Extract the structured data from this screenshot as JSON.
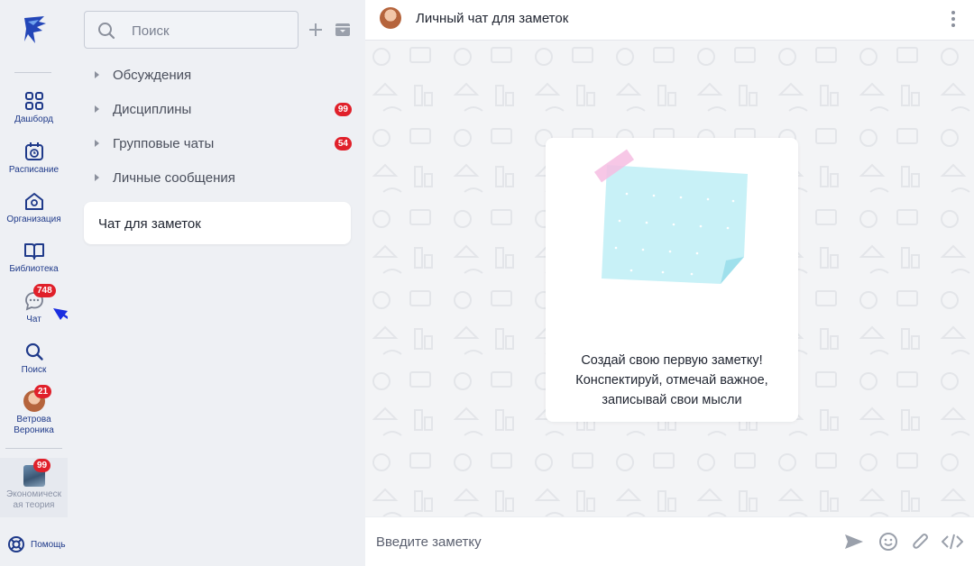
{
  "rail": {
    "items": [
      {
        "label": "Дашборд",
        "icon": "dashboard-icon"
      },
      {
        "label": "Расписание",
        "icon": "calendar-icon"
      },
      {
        "label": "Организация",
        "icon": "organization-icon"
      },
      {
        "label": "Библиотека",
        "icon": "book-icon"
      },
      {
        "label": "Чат",
        "icon": "chat-icon",
        "badge": "748"
      },
      {
        "label": "Поиск",
        "icon": "search-icon"
      }
    ],
    "profile": {
      "name_line1": "Ветрова",
      "name_line2": "Вероника",
      "badge": "21"
    },
    "course": {
      "name_line1": "Экономическ",
      "name_line2": "ая теория",
      "badge": "99"
    },
    "help_label": "Помощь"
  },
  "list": {
    "search_placeholder": "Поиск",
    "groups": [
      {
        "label": "Обсуждения",
        "badge": ""
      },
      {
        "label": "Дисциплины",
        "badge": "99"
      },
      {
        "label": "Групповые чаты",
        "badge": "54"
      },
      {
        "label": "Личные сообщения",
        "badge": ""
      }
    ],
    "notes_chat": "Чат для заметок"
  },
  "chat": {
    "title": "Личный чат для заметок",
    "empty_line1": "Создай свою первую заметку!",
    "empty_line2": "Конспектируй, отмечай важное,",
    "empty_line3": "записывай свои мысли",
    "composer_placeholder": "Введите заметку"
  },
  "colors": {
    "accent": "#1f3a8a",
    "badge": "#e0202a",
    "annotation_arrow": "#1a2ee0"
  }
}
